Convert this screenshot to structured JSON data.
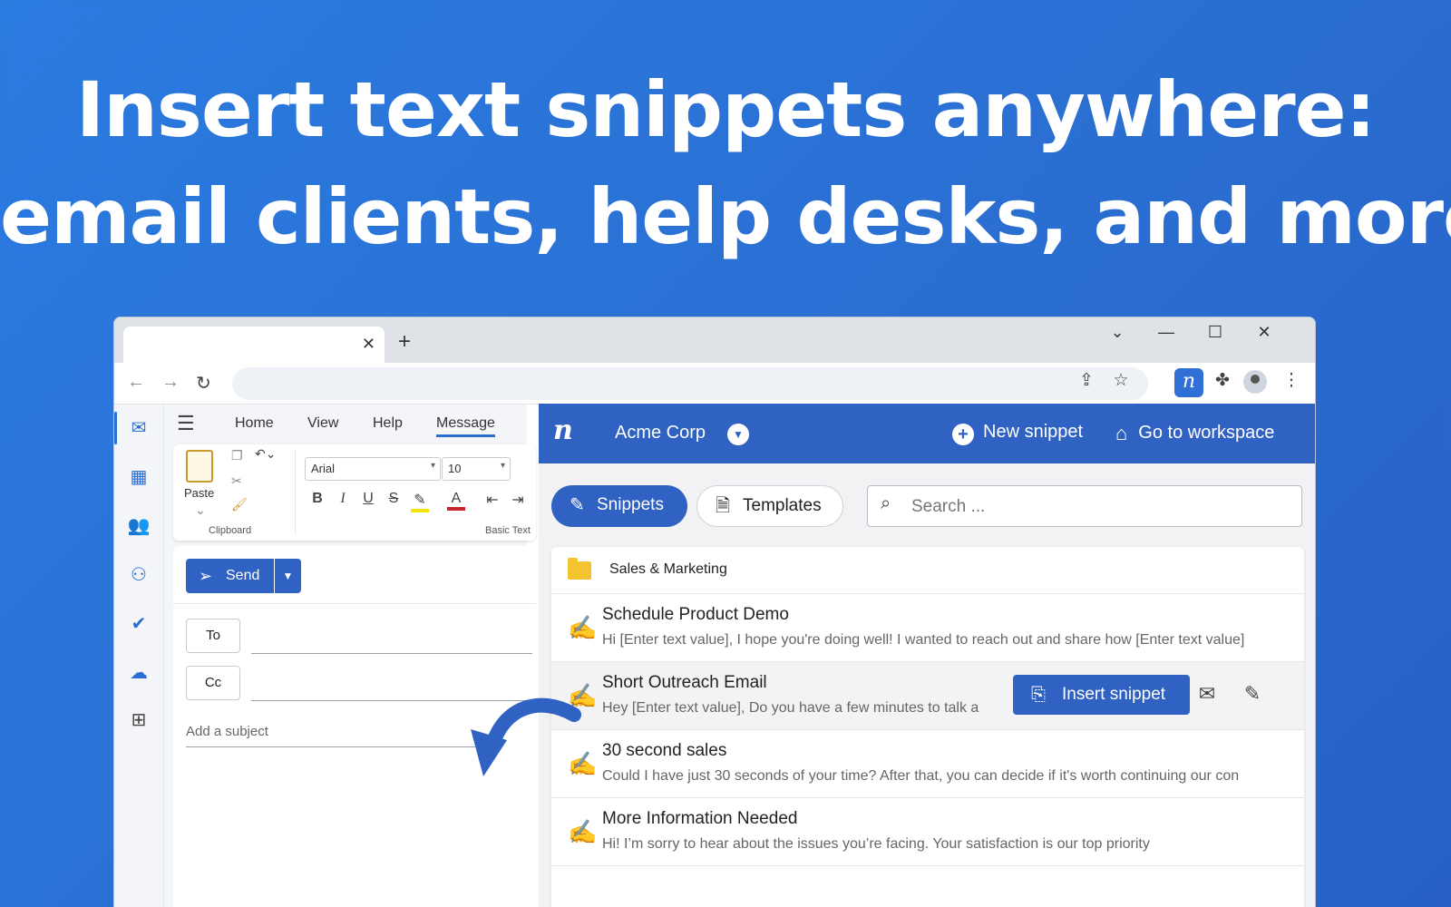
{
  "headline": {
    "line1": "Insert text snippets anywhere:",
    "line2": "email clients, help desks, and more"
  },
  "browser": {
    "new_tab_glyph": "+",
    "tab_close_glyph": "✕",
    "window_controls": [
      "⌄",
      "—",
      "☐",
      "✕"
    ]
  },
  "outlook": {
    "menu": [
      "Home",
      "View",
      "Help",
      "Message"
    ],
    "active_menu": "Message",
    "ribbon": {
      "paste_label": "Paste",
      "clipboard_label": "Clipboard",
      "basic_text_label": "Basic Text",
      "font": "Arial",
      "font_size": "10"
    },
    "compose": {
      "send_label": "Send",
      "to_label": "To",
      "cc_label": "Cc",
      "subject_placeholder": "Add a subject"
    }
  },
  "panel": {
    "workspace": "Acme Corp",
    "new_snippet_label": "New snippet",
    "go_to_workspace_label": "Go to workspace",
    "tabs": {
      "snippets": "Snippets",
      "templates": "Templates"
    },
    "search_placeholder": "Search ...",
    "folder": "Sales & Marketing",
    "insert_label": "Insert snippet",
    "snippets": [
      {
        "title": "Schedule Product Demo",
        "preview": "Hi [Enter text value], I hope you're doing well! I wanted to reach out and share how [Enter text value]"
      },
      {
        "title": "Short Outreach Email",
        "preview": "Hey [Enter text value], Do you have a few minutes to talk a"
      },
      {
        "title": "30 second sales",
        "preview": "Could I have just 30 seconds of your time? After that, you can decide if it's worth continuing our con"
      },
      {
        "title": "More Information Needed",
        "preview": "Hi! I’m sorry to hear about the issues you’re facing. Your satisfaction is our top priority"
      }
    ]
  },
  "colors": {
    "background": "#2a6fd8",
    "accent": "#2f62c2",
    "folder": "#f4c430"
  }
}
